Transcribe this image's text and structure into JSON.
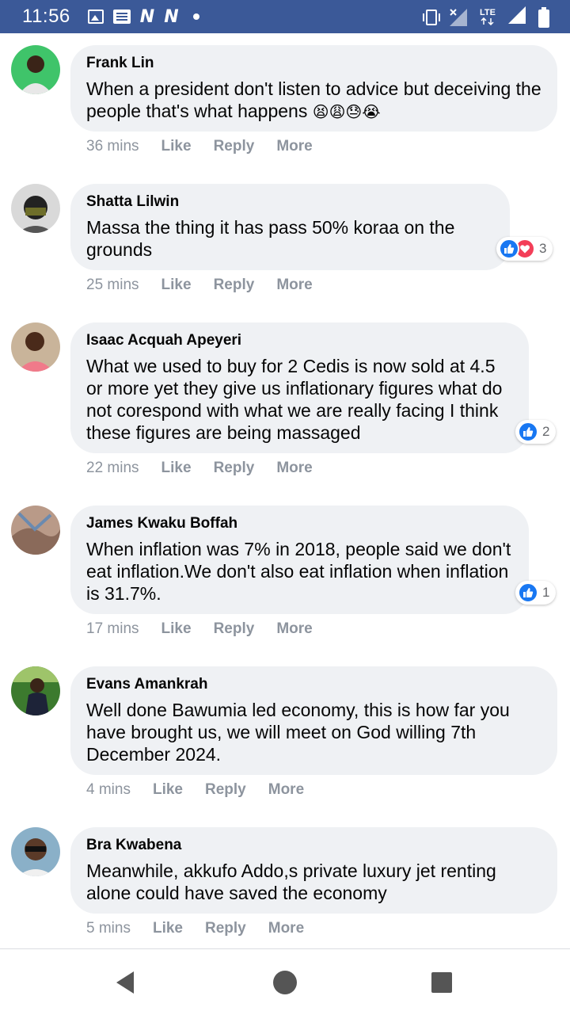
{
  "status_bar": {
    "time": "11:56",
    "left_icons": [
      "image-icon",
      "news-icon",
      "n-icon",
      "n-icon",
      "dot-icon"
    ],
    "n1": "N",
    "n2": "N",
    "network": "LTE",
    "right_icons": [
      "vibrate-icon",
      "signal-x-icon",
      "lte-icon",
      "signal-icon",
      "battery-icon"
    ],
    "color": "#3b5998"
  },
  "comments": [
    {
      "author": "Frank Lin",
      "text": "When a president don't listen to advice but deceiving the people that's what happens",
      "emojis": "😫😩😓😭",
      "time": "36 mins",
      "like": "Like",
      "reply": "Reply",
      "more": "More"
    },
    {
      "author": "Shatta Lilwin",
      "text": "Massa the thing it has pass 50% koraa on the grounds",
      "time": "25 mins",
      "like": "Like",
      "reply": "Reply",
      "more": "More",
      "reaction_count": "3"
    },
    {
      "author": "Isaac Acquah Apeyeri",
      "text": "What we used to buy for 2 Cedis is now sold at 4.5 or more yet they give us inflationary figures what do not corespond with what we are really facing I think these figures are being massaged",
      "time": "22 mins",
      "like": "Like",
      "reply": "Reply",
      "more": "More",
      "reaction_count": "2"
    },
    {
      "author": "James Kwaku Boffah",
      "text": "When inflation was 7% in 2018, people said we don't eat inflation.We don't also eat inflation when inflation is 31.7%.",
      "time": "17 mins",
      "like": "Like",
      "reply": "Reply",
      "more": "More",
      "reaction_count": "1"
    },
    {
      "author": "Evans Amankrah",
      "text": "Well done Bawumia led economy, this is how far you have brought us, we will meet on God willing 7th December 2024.",
      "time": "4 mins",
      "like": "Like",
      "reply": "Reply",
      "more": "More"
    },
    {
      "author": "Bra Kwabena",
      "text": "Meanwhile, akkufo Addo,s private luxury jet renting alone could have saved the economy",
      "time": "5 mins",
      "like": "Like",
      "reply": "Reply",
      "more": "More"
    }
  ],
  "nav": {
    "icons": [
      "back-icon",
      "home-icon",
      "recents-icon"
    ]
  },
  "colors": {
    "bubble": "#eff1f4",
    "meta_text": "#8d949e",
    "like_blue": "#1877f2",
    "love_red": "#f33e58"
  }
}
